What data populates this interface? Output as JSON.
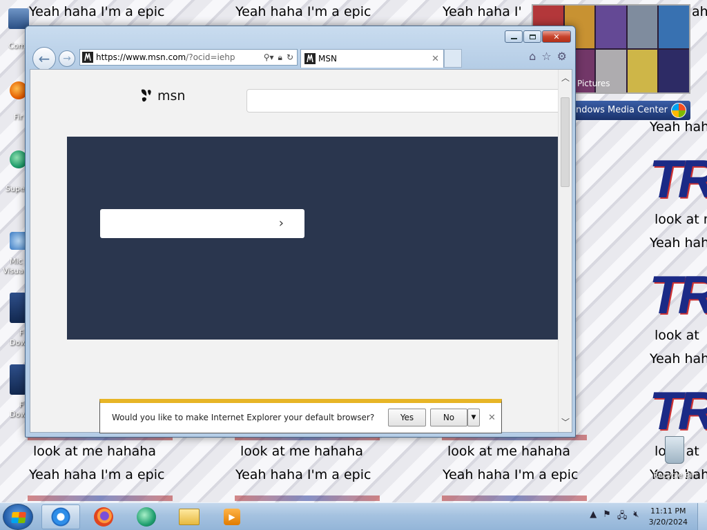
{
  "wallpaper": {
    "epic": "Yeah haha I'm a epic",
    "epic_partial": "Yeah hah",
    "look": "look at me hahaha",
    "look_partial": "look at m",
    "look_partial2": "look at ",
    "epic_cut_right": "ah",
    "epic_cut_mid": "Yeah haha I'",
    "logo": "TR"
  },
  "desktop_icons": {
    "computer": "Com",
    "firefox": "Fir",
    "super": "Supe",
    "visual_line1": "Mic",
    "visual_line2": "Visua",
    "download1_line1": "F",
    "download1_line2": "Dow",
    "download2_line1": "F",
    "download2_line2": "Dow",
    "recycle": "Recycle Bin"
  },
  "gadget": {
    "pictures_label": "Pictures",
    "bar_label": "ndows Media Center"
  },
  "browser": {
    "url_main": "https://www.msn.com",
    "url_rest": "/?ocid=iehp",
    "tab_title": "MSN",
    "site_icon_glyph": "msn-favicon"
  },
  "msn": {
    "logo_text": "msn",
    "search_placeholder": ""
  },
  "notification": {
    "message": "Would you like to make Internet Explorer your default browser?",
    "yes": "Yes",
    "no": "No"
  },
  "taskbar": {
    "time": "11:11 PM",
    "date": "3/20/2024"
  }
}
